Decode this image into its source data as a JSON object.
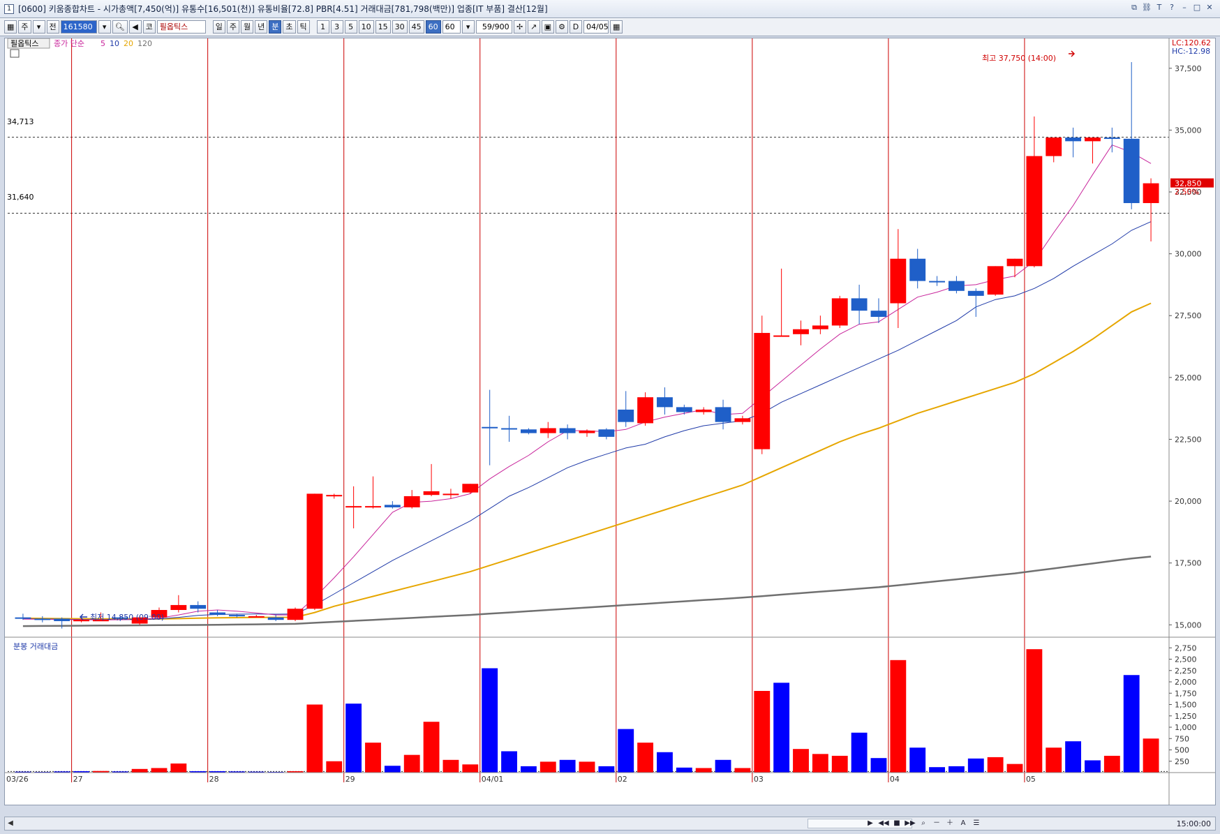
{
  "window": {
    "number": "1",
    "title": "[0600] 키움종합차트 - 시가총액[7,450(억)] 유통수[16,501(천)] 유통비율[72.8] PBR[4.51] 거래대금[781,798(백만)] 업종[IT 부품] 결산[12월]"
  },
  "toolbar": {
    "week_label": "주",
    "all_label": "전",
    "code_value": "161580",
    "market_label": "코",
    "stock_name": "필옵틱스",
    "period_buttons": [
      "일",
      "주",
      "월",
      "년",
      "분",
      "초",
      "틱"
    ],
    "active_period": "분",
    "interval_buttons": [
      "1",
      "3",
      "5",
      "10",
      "15",
      "30",
      "45",
      "60"
    ],
    "active_interval": "60",
    "interval_select": "60",
    "count_value": "59/900",
    "date_value": "04/05"
  },
  "legend": {
    "stock": "필옵틱스",
    "ma_label": "종가 단순",
    "ma_periods": [
      "5",
      "10",
      "20",
      "120"
    ],
    "ma_colors": [
      "#c8249b",
      "#1f3aa8",
      "#e6a600",
      "#707070"
    ]
  },
  "price_info": {
    "lc": "LC:120.62",
    "hc": "HC:-12.98",
    "high_note": "최고 37,750 (14:00)",
    "low_note": "최저 14,850 (09:00)",
    "current_price": "32,850",
    "current_change": "2.50%",
    "ref_line_1": "34,713",
    "ref_line_2": "31,640"
  },
  "volume_panel": {
    "title": "분봉 거래대금"
  },
  "bottom": {
    "time_label": "15:00:00"
  },
  "colors": {
    "up": "#ff0000",
    "down": "#1f5fc8",
    "vol_up": "#ff0000",
    "vol_down": "#0000ff",
    "day_line": "#cc0000"
  },
  "chart_data": [
    {
      "type": "candlestick",
      "title": "필옵틱스 60분봉",
      "y_axis_ticks": [
        15000,
        17500,
        20000,
        22500,
        25000,
        27500,
        30000,
        32500,
        35000,
        37500
      ],
      "y_axis_labels": [
        "15,000",
        "17,500",
        "20,000",
        "22,500",
        "25,000",
        "27,500",
        "30,000",
        "32,500",
        "35,000",
        "37,500"
      ],
      "ylim": [
        14500,
        38200
      ],
      "x_labels": [
        "03/26",
        "27",
        "28",
        "29",
        "04/01",
        "02",
        "03",
        "04",
        "05"
      ],
      "day_start_index": [
        0,
        3,
        10,
        17,
        24,
        31,
        38,
        45,
        52
      ],
      "candles": [
        {
          "o": 15300,
          "h": 15450,
          "l": 15200,
          "c": 15250
        },
        {
          "o": 15250,
          "h": 15350,
          "l": 15100,
          "c": 15200
        },
        {
          "o": 15250,
          "h": 15300,
          "l": 14850,
          "c": 15150
        },
        {
          "o": 15200,
          "h": 15250,
          "l": 15100,
          "c": 15200
        },
        {
          "o": 15200,
          "h": 15500,
          "l": 15150,
          "c": 15200
        },
        {
          "o": 15300,
          "h": 15350,
          "l": 15150,
          "c": 15250
        },
        {
          "o": 15050,
          "h": 15350,
          "l": 15000,
          "c": 15300
        },
        {
          "o": 15300,
          "h": 15700,
          "l": 15250,
          "c": 15600
        },
        {
          "o": 15600,
          "h": 16200,
          "l": 15500,
          "c": 15800
        },
        {
          "o": 15800,
          "h": 15950,
          "l": 15500,
          "c": 15650
        },
        {
          "o": 15500,
          "h": 15600,
          "l": 15350,
          "c": 15400
        },
        {
          "o": 15400,
          "h": 15450,
          "l": 15300,
          "c": 15350
        },
        {
          "o": 15350,
          "h": 15400,
          "l": 15300,
          "c": 15350
        },
        {
          "o": 15300,
          "h": 15400,
          "l": 15150,
          "c": 15200
        },
        {
          "o": 15200,
          "h": 15700,
          "l": 15150,
          "c": 15650
        },
        {
          "o": 15650,
          "h": 20300,
          "l": 15600,
          "c": 20300
        },
        {
          "o": 20250,
          "h": 20300,
          "l": 20100,
          "c": 20250
        },
        {
          "o": 19800,
          "h": 20600,
          "l": 18900,
          "c": 19800
        },
        {
          "o": 19750,
          "h": 21000,
          "l": 19700,
          "c": 19800
        },
        {
          "o": 19850,
          "h": 20000,
          "l": 19700,
          "c": 19750
        },
        {
          "o": 19750,
          "h": 20450,
          "l": 19700,
          "c": 20200
        },
        {
          "o": 20250,
          "h": 21500,
          "l": 20200,
          "c": 20400
        },
        {
          "o": 20300,
          "h": 20500,
          "l": 20100,
          "c": 20300
        },
        {
          "o": 20350,
          "h": 20700,
          "l": 20300,
          "c": 20700
        },
        {
          "o": 23000,
          "h": 24500,
          "l": 21450,
          "c": 22950
        },
        {
          "o": 22950,
          "h": 23450,
          "l": 22400,
          "c": 22900
        },
        {
          "o": 22900,
          "h": 22950,
          "l": 22700,
          "c": 22750
        },
        {
          "o": 22750,
          "h": 23200,
          "l": 22550,
          "c": 22950
        },
        {
          "o": 22950,
          "h": 23100,
          "l": 22500,
          "c": 22750
        },
        {
          "o": 22750,
          "h": 22900,
          "l": 22600,
          "c": 22850
        },
        {
          "o": 22900,
          "h": 22950,
          "l": 22500,
          "c": 22600
        },
        {
          "o": 23700,
          "h": 24450,
          "l": 23000,
          "c": 23200
        },
        {
          "o": 23150,
          "h": 24400,
          "l": 23050,
          "c": 24200
        },
        {
          "o": 24200,
          "h": 24600,
          "l": 23500,
          "c": 23800
        },
        {
          "o": 23800,
          "h": 23900,
          "l": 23500,
          "c": 23600
        },
        {
          "o": 23600,
          "h": 23800,
          "l": 23500,
          "c": 23700
        },
        {
          "o": 23800,
          "h": 24100,
          "l": 22900,
          "c": 23200
        },
        {
          "o": 23200,
          "h": 23450,
          "l": 23100,
          "c": 23350
        },
        {
          "o": 22100,
          "h": 27500,
          "l": 21900,
          "c": 26800
        },
        {
          "o": 26700,
          "h": 29400,
          "l": 26650,
          "c": 26700
        },
        {
          "o": 26750,
          "h": 27300,
          "l": 26300,
          "c": 26950
        },
        {
          "o": 26950,
          "h": 27500,
          "l": 26750,
          "c": 27100
        },
        {
          "o": 27100,
          "h": 28300,
          "l": 27000,
          "c": 28200
        },
        {
          "o": 28200,
          "h": 28750,
          "l": 27150,
          "c": 27700
        },
        {
          "o": 27700,
          "h": 28200,
          "l": 27200,
          "c": 27450
        },
        {
          "o": 28000,
          "h": 31000,
          "l": 27000,
          "c": 29800
        },
        {
          "o": 29800,
          "h": 30200,
          "l": 28600,
          "c": 28900
        },
        {
          "o": 28900,
          "h": 29100,
          "l": 28700,
          "c": 28850
        },
        {
          "o": 28900,
          "h": 29100,
          "l": 28400,
          "c": 28500
        },
        {
          "o": 28500,
          "h": 28600,
          "l": 27450,
          "c": 28300
        },
        {
          "o": 28350,
          "h": 29500,
          "l": 28300,
          "c": 29500
        },
        {
          "o": 29500,
          "h": 29800,
          "l": 29050,
          "c": 29800
        },
        {
          "o": 29500,
          "h": 35550,
          "l": 29450,
          "c": 33950
        },
        {
          "o": 33950,
          "h": 34700,
          "l": 33700,
          "c": 34700
        },
        {
          "o": 34700,
          "h": 35100,
          "l": 33900,
          "c": 34550
        },
        {
          "o": 34550,
          "h": 34700,
          "l": 33650,
          "c": 34700
        },
        {
          "o": 34700,
          "h": 35100,
          "l": 34100,
          "c": 34650
        },
        {
          "o": 34650,
          "h": 37750,
          "l": 31800,
          "c": 32050
        },
        {
          "o": 32050,
          "h": 33050,
          "l": 30500,
          "c": 32850
        }
      ],
      "ma5": [
        15230,
        15225,
        15215,
        15205,
        15200,
        15205,
        15220,
        15270,
        15400,
        15550,
        15600,
        15550,
        15480,
        15400,
        15400,
        16100,
        16900,
        17750,
        18650,
        19550,
        19950,
        20000,
        20100,
        20300,
        20900,
        21400,
        21850,
        22400,
        22850,
        22850,
        22800,
        22900,
        23200,
        23400,
        23550,
        23700,
        23500,
        23550,
        24200,
        24850,
        25500,
        26150,
        26750,
        27150,
        27250,
        27750,
        28250,
        28450,
        28700,
        28750,
        28950,
        29100,
        29700,
        30850,
        31950,
        33200,
        34400,
        34100,
        33650
      ],
      "ma10": [
        15240,
        15235,
        15225,
        15215,
        15210,
        15210,
        15215,
        15240,
        15300,
        15380,
        15420,
        15430,
        15440,
        15430,
        15440,
        15800,
        16250,
        16700,
        17150,
        17600,
        18000,
        18400,
        18800,
        19200,
        19700,
        20200,
        20550,
        20950,
        21350,
        21650,
        21900,
        22150,
        22300,
        22600,
        22850,
        23050,
        23150,
        23250,
        23550,
        24000,
        24350,
        24700,
        25050,
        25400,
        25750,
        26100,
        26500,
        26900,
        27300,
        27850,
        28150,
        28300,
        28600,
        29000,
        29500,
        29950,
        30400,
        30950,
        31300
      ],
      "ma20": [
        15270,
        15260,
        15250,
        15245,
        15240,
        15235,
        15230,
        15235,
        15250,
        15270,
        15285,
        15290,
        15300,
        15300,
        15305,
        15500,
        15750,
        15950,
        16150,
        16350,
        16550,
        16750,
        16950,
        17150,
        17400,
        17650,
        17900,
        18150,
        18400,
        18650,
        18900,
        19150,
        19400,
        19650,
        19900,
        20150,
        20400,
        20650,
        21000,
        21350,
        21700,
        22050,
        22400,
        22700,
        22950,
        23250,
        23550,
        23800,
        24050,
        24300,
        24550,
        24800,
        25150,
        25600,
        26050,
        26550,
        27100,
        27650,
        28000
      ],
      "ma120": [
        14950,
        14955,
        14960,
        14965,
        14970,
        14975,
        14980,
        14985,
        14990,
        14995,
        15000,
        15010,
        15020,
        15030,
        15040,
        15080,
        15120,
        15160,
        15200,
        15240,
        15280,
        15320,
        15360,
        15400,
        15450,
        15500,
        15550,
        15600,
        15650,
        15700,
        15750,
        15800,
        15850,
        15900,
        15950,
        16000,
        16050,
        16100,
        16160,
        16220,
        16280,
        16340,
        16400,
        16460,
        16520,
        16600,
        16680,
        16760,
        16840,
        16920,
        17000,
        17080,
        17180,
        17280,
        17380,
        17480,
        17580,
        17680,
        17760
      ]
    },
    {
      "type": "bar",
      "title": "분봉 거래대금",
      "y_axis_ticks": [
        250,
        500,
        750,
        1000,
        1250,
        1500,
        1750,
        2000,
        2250,
        2500,
        2750
      ],
      "y_axis_labels": [
        "250,000",
        "500,000",
        "750,000",
        "1,000,000",
        "1,250,000",
        "1,500,000",
        "1,750,000",
        "2,000,000",
        "2,250,000",
        "2,500,000",
        "2,750,000"
      ],
      "ylim": [
        0,
        2800
      ],
      "values": [
        20,
        15,
        25,
        30,
        35,
        25,
        80,
        100,
        200,
        30,
        30,
        25,
        20,
        15,
        30,
        1500,
        250,
        1520,
        660,
        150,
        390,
        1120,
        280,
        180,
        2300,
        470,
        140,
        240,
        280,
        240,
        140,
        960,
        660,
        450,
        110,
        100,
        280,
        100,
        1800,
        1980,
        520,
        410,
        370,
        880,
        320,
        2480,
        550,
        120,
        140,
        310,
        340,
        190,
        2720,
        550,
        690,
        270,
        370,
        2150,
        750
      ],
      "up": [
        false,
        false,
        false,
        false,
        true,
        false,
        true,
        true,
        true,
        false,
        false,
        false,
        false,
        false,
        true,
        true,
        true,
        false,
        true,
        false,
        true,
        true,
        true,
        true,
        false,
        false,
        false,
        true,
        false,
        true,
        false,
        false,
        true,
        false,
        false,
        true,
        false,
        true,
        true,
        false,
        true,
        true,
        true,
        false,
        false,
        true,
        false,
        false,
        false,
        false,
        true,
        true,
        true,
        true,
        false,
        false,
        true,
        false,
        true
      ]
    }
  ]
}
